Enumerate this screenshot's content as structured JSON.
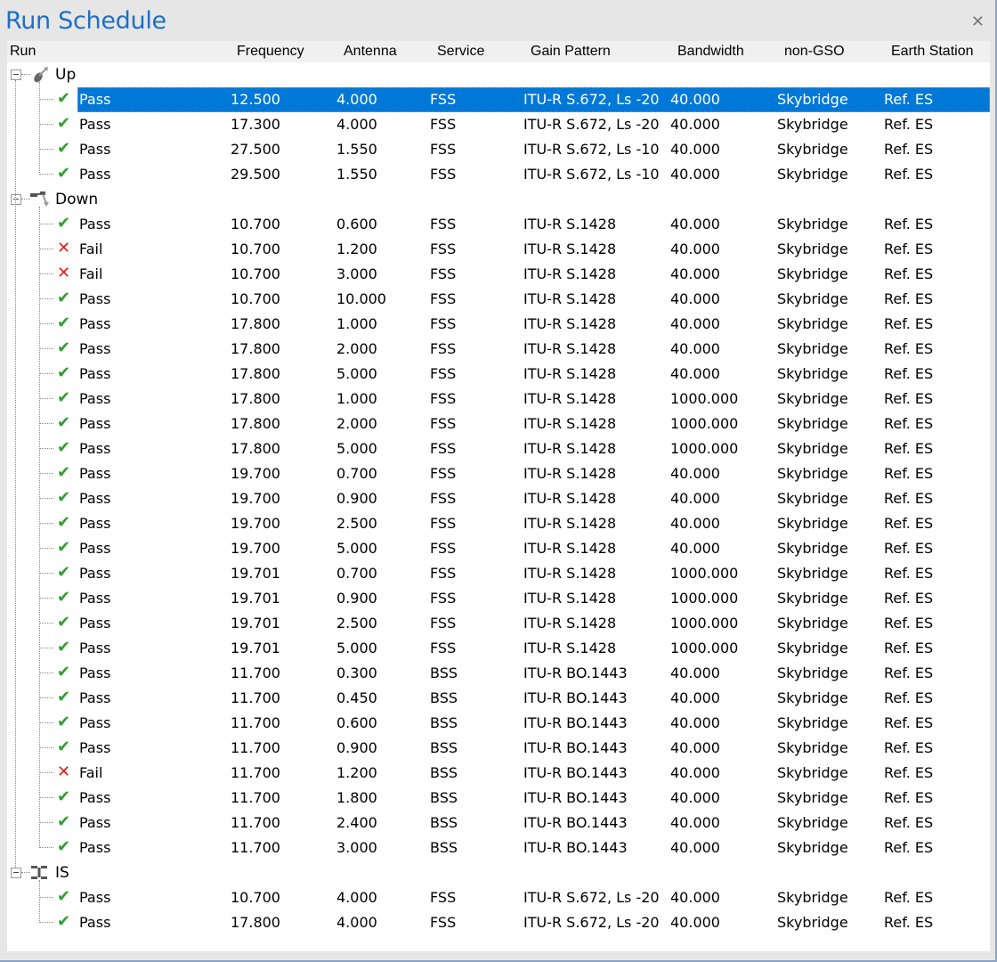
{
  "window": {
    "title": "Run Schedule",
    "close_icon": "close-icon"
  },
  "columns": [
    "Run",
    "Frequency",
    "Antenna",
    "Service",
    "Gain Pattern",
    "Bandwidth",
    "non-GSO",
    "Earth Station"
  ],
  "groups": [
    {
      "label": "Up",
      "icon": "uplink-dish-icon",
      "rows": [
        {
          "status": "pass",
          "run": "Pass",
          "frequency": "12.500",
          "antenna": "4.000",
          "service": "FSS",
          "gain": "ITU-R S.672, Ls -20",
          "bandwidth": "40.000",
          "nongso": "Skybridge",
          "es": "Ref. ES",
          "selected": true
        },
        {
          "status": "pass",
          "run": "Pass",
          "frequency": "17.300",
          "antenna": "4.000",
          "service": "FSS",
          "gain": "ITU-R S.672, Ls -20",
          "bandwidth": "40.000",
          "nongso": "Skybridge",
          "es": "Ref. ES"
        },
        {
          "status": "pass",
          "run": "Pass",
          "frequency": "27.500",
          "antenna": "1.550",
          "service": "FSS",
          "gain": "ITU-R S.672, Ls -10",
          "bandwidth": "40.000",
          "nongso": "Skybridge",
          "es": "Ref. ES"
        },
        {
          "status": "pass",
          "run": "Pass",
          "frequency": "29.500",
          "antenna": "1.550",
          "service": "FSS",
          "gain": "ITU-R S.672, Ls -10",
          "bandwidth": "40.000",
          "nongso": "Skybridge",
          "es": "Ref. ES"
        }
      ]
    },
    {
      "label": "Down",
      "icon": "downlink-satellite-icon",
      "rows": [
        {
          "status": "pass",
          "run": "Pass",
          "frequency": "10.700",
          "antenna": "0.600",
          "service": "FSS",
          "gain": "ITU-R S.1428",
          "bandwidth": "40.000",
          "nongso": "Skybridge",
          "es": "Ref. ES"
        },
        {
          "status": "fail",
          "run": "Fail",
          "frequency": "10.700",
          "antenna": "1.200",
          "service": "FSS",
          "gain": "ITU-R S.1428",
          "bandwidth": "40.000",
          "nongso": "Skybridge",
          "es": "Ref. ES"
        },
        {
          "status": "fail",
          "run": "Fail",
          "frequency": "10.700",
          "antenna": "3.000",
          "service": "FSS",
          "gain": "ITU-R S.1428",
          "bandwidth": "40.000",
          "nongso": "Skybridge",
          "es": "Ref. ES"
        },
        {
          "status": "pass",
          "run": "Pass",
          "frequency": "10.700",
          "antenna": "10.000",
          "service": "FSS",
          "gain": "ITU-R S.1428",
          "bandwidth": "40.000",
          "nongso": "Skybridge",
          "es": "Ref. ES"
        },
        {
          "status": "pass",
          "run": "Pass",
          "frequency": "17.800",
          "antenna": "1.000",
          "service": "FSS",
          "gain": "ITU-R S.1428",
          "bandwidth": "40.000",
          "nongso": "Skybridge",
          "es": "Ref. ES"
        },
        {
          "status": "pass",
          "run": "Pass",
          "frequency": "17.800",
          "antenna": "2.000",
          "service": "FSS",
          "gain": "ITU-R S.1428",
          "bandwidth": "40.000",
          "nongso": "Skybridge",
          "es": "Ref. ES"
        },
        {
          "status": "pass",
          "run": "Pass",
          "frequency": "17.800",
          "antenna": "5.000",
          "service": "FSS",
          "gain": "ITU-R S.1428",
          "bandwidth": "40.000",
          "nongso": "Skybridge",
          "es": "Ref. ES"
        },
        {
          "status": "pass",
          "run": "Pass",
          "frequency": "17.800",
          "antenna": "1.000",
          "service": "FSS",
          "gain": "ITU-R S.1428",
          "bandwidth": "1000.000",
          "nongso": "Skybridge",
          "es": "Ref. ES"
        },
        {
          "status": "pass",
          "run": "Pass",
          "frequency": "17.800",
          "antenna": "2.000",
          "service": "FSS",
          "gain": "ITU-R S.1428",
          "bandwidth": "1000.000",
          "nongso": "Skybridge",
          "es": "Ref. ES"
        },
        {
          "status": "pass",
          "run": "Pass",
          "frequency": "17.800",
          "antenna": "5.000",
          "service": "FSS",
          "gain": "ITU-R S.1428",
          "bandwidth": "1000.000",
          "nongso": "Skybridge",
          "es": "Ref. ES"
        },
        {
          "status": "pass",
          "run": "Pass",
          "frequency": "19.700",
          "antenna": "0.700",
          "service": "FSS",
          "gain": "ITU-R S.1428",
          "bandwidth": "40.000",
          "nongso": "Skybridge",
          "es": "Ref. ES"
        },
        {
          "status": "pass",
          "run": "Pass",
          "frequency": "19.700",
          "antenna": "0.900",
          "service": "FSS",
          "gain": "ITU-R S.1428",
          "bandwidth": "40.000",
          "nongso": "Skybridge",
          "es": "Ref. ES"
        },
        {
          "status": "pass",
          "run": "Pass",
          "frequency": "19.700",
          "antenna": "2.500",
          "service": "FSS",
          "gain": "ITU-R S.1428",
          "bandwidth": "40.000",
          "nongso": "Skybridge",
          "es": "Ref. ES"
        },
        {
          "status": "pass",
          "run": "Pass",
          "frequency": "19.700",
          "antenna": "5.000",
          "service": "FSS",
          "gain": "ITU-R S.1428",
          "bandwidth": "40.000",
          "nongso": "Skybridge",
          "es": "Ref. ES"
        },
        {
          "status": "pass",
          "run": "Pass",
          "frequency": "19.701",
          "antenna": "0.700",
          "service": "FSS",
          "gain": "ITU-R S.1428",
          "bandwidth": "1000.000",
          "nongso": "Skybridge",
          "es": "Ref. ES"
        },
        {
          "status": "pass",
          "run": "Pass",
          "frequency": "19.701",
          "antenna": "0.900",
          "service": "FSS",
          "gain": "ITU-R S.1428",
          "bandwidth": "1000.000",
          "nongso": "Skybridge",
          "es": "Ref. ES"
        },
        {
          "status": "pass",
          "run": "Pass",
          "frequency": "19.701",
          "antenna": "2.500",
          "service": "FSS",
          "gain": "ITU-R S.1428",
          "bandwidth": "1000.000",
          "nongso": "Skybridge",
          "es": "Ref. ES"
        },
        {
          "status": "pass",
          "run": "Pass",
          "frequency": "19.701",
          "antenna": "5.000",
          "service": "FSS",
          "gain": "ITU-R S.1428",
          "bandwidth": "1000.000",
          "nongso": "Skybridge",
          "es": "Ref. ES"
        },
        {
          "status": "pass",
          "run": "Pass",
          "frequency": "11.700",
          "antenna": "0.300",
          "service": "BSS",
          "gain": "ITU-R BO.1443",
          "bandwidth": "40.000",
          "nongso": "Skybridge",
          "es": "Ref. ES"
        },
        {
          "status": "pass",
          "run": "Pass",
          "frequency": "11.700",
          "antenna": "0.450",
          "service": "BSS",
          "gain": "ITU-R BO.1443",
          "bandwidth": "40.000",
          "nongso": "Skybridge",
          "es": "Ref. ES"
        },
        {
          "status": "pass",
          "run": "Pass",
          "frequency": "11.700",
          "antenna": "0.600",
          "service": "BSS",
          "gain": "ITU-R BO.1443",
          "bandwidth": "40.000",
          "nongso": "Skybridge",
          "es": "Ref. ES"
        },
        {
          "status": "pass",
          "run": "Pass",
          "frequency": "11.700",
          "antenna": "0.900",
          "service": "BSS",
          "gain": "ITU-R BO.1443",
          "bandwidth": "40.000",
          "nongso": "Skybridge",
          "es": "Ref. ES"
        },
        {
          "status": "fail",
          "run": "Fail",
          "frequency": "11.700",
          "antenna": "1.200",
          "service": "BSS",
          "gain": "ITU-R BO.1443",
          "bandwidth": "40.000",
          "nongso": "Skybridge",
          "es": "Ref. ES"
        },
        {
          "status": "pass",
          "run": "Pass",
          "frequency": "11.700",
          "antenna": "1.800",
          "service": "BSS",
          "gain": "ITU-R BO.1443",
          "bandwidth": "40.000",
          "nongso": "Skybridge",
          "es": "Ref. ES"
        },
        {
          "status": "pass",
          "run": "Pass",
          "frequency": "11.700",
          "antenna": "2.400",
          "service": "BSS",
          "gain": "ITU-R BO.1443",
          "bandwidth": "40.000",
          "nongso": "Skybridge",
          "es": "Ref. ES"
        },
        {
          "status": "pass",
          "run": "Pass",
          "frequency": "11.700",
          "antenna": "3.000",
          "service": "BSS",
          "gain": "ITU-R BO.1443",
          "bandwidth": "40.000",
          "nongso": "Skybridge",
          "es": "Ref. ES"
        }
      ]
    },
    {
      "label": "IS",
      "icon": "inter-satellite-icon",
      "rows": [
        {
          "status": "pass",
          "run": "Pass",
          "frequency": "10.700",
          "antenna": "4.000",
          "service": "FSS",
          "gain": "ITU-R S.672, Ls -20",
          "bandwidth": "40.000",
          "nongso": "Skybridge",
          "es": "Ref. ES"
        },
        {
          "status": "pass",
          "run": "Pass",
          "frequency": "17.800",
          "antenna": "4.000",
          "service": "FSS",
          "gain": "ITU-R S.672, Ls -20",
          "bandwidth": "40.000",
          "nongso": "Skybridge",
          "es": "Ref. ES"
        }
      ]
    }
  ],
  "status_icons": {
    "pass": "✔",
    "fail": "✕"
  },
  "colors": {
    "accent": "#0078d7",
    "title": "#1b6fc8",
    "pass": "#2f9e2f",
    "fail": "#e0201a"
  }
}
